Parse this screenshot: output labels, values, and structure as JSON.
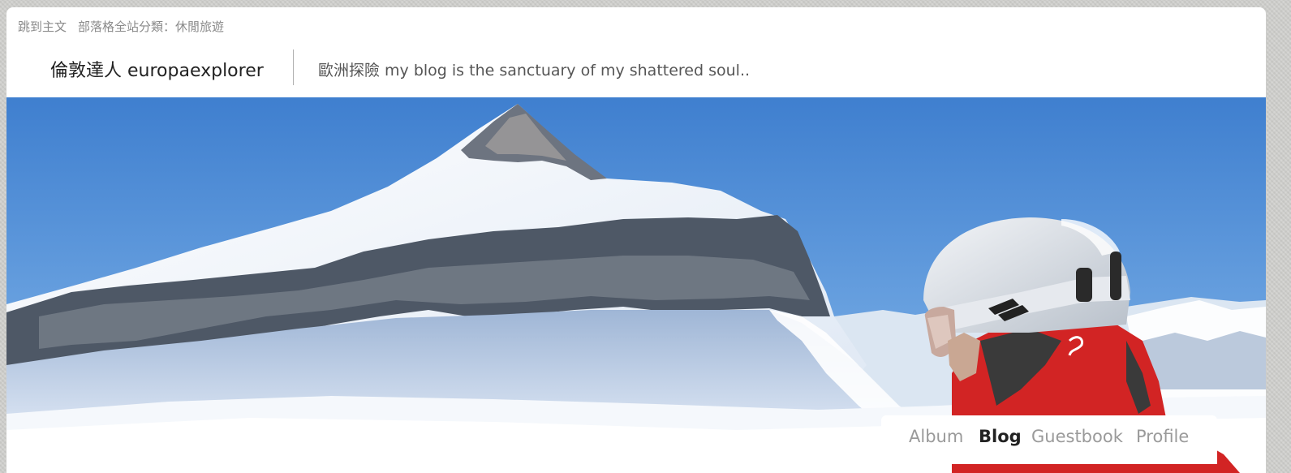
{
  "topbar": {
    "skip_link": "跳到主文",
    "category_prefix": "部落格全站分類：",
    "category_value": "休閒旅遊"
  },
  "header": {
    "title": "倫敦達人 europaexplorer",
    "description": "歐洲探險 my blog is the sanctuary of my shattered soul.."
  },
  "menu": {
    "items": [
      {
        "label": "Album",
        "active": false
      },
      {
        "label": "Blog",
        "active": true
      },
      {
        "label": "Guestbook",
        "active": false
      },
      {
        "label": "Profile",
        "active": false
      }
    ]
  },
  "banner": {
    "icon": "mountain-skier-photo"
  },
  "colors": {
    "sky": "#4f8fd4",
    "jacket": "#d42a2a",
    "active_menu": "#222222",
    "inactive_menu": "#9a9a9a"
  }
}
